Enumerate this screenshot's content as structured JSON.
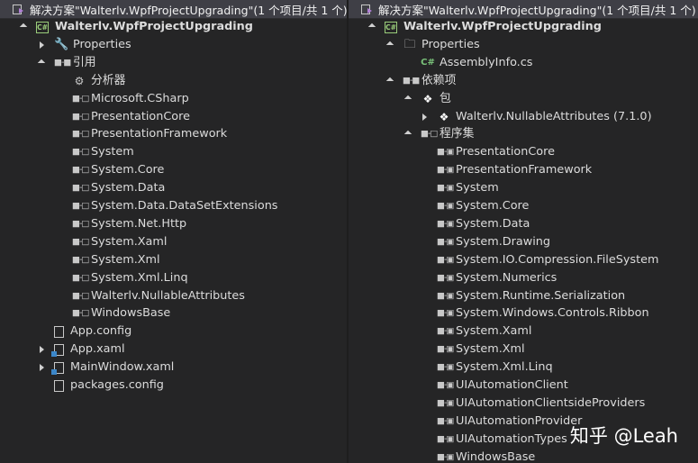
{
  "left": {
    "header": "解决方案\"Walterlv.WpfProjectUpgrading\"(1 个项目/共 1 个)",
    "rows": [
      {
        "depth": 1,
        "toggle": "expanded",
        "icon": "csharp-project-icon",
        "glyph": "C#",
        "label": "Walterlv.WpfProjectUpgrading",
        "bold": true
      },
      {
        "depth": 2,
        "toggle": "collapsed",
        "icon": "wrench-icon",
        "glyph": "🔧",
        "label": "Properties"
      },
      {
        "depth": 2,
        "toggle": "expanded",
        "icon": "references-icon",
        "glyph": "■-■",
        "label": "引用"
      },
      {
        "depth": 3,
        "toggle": "none",
        "icon": "analyzer-icon",
        "glyph": "⚙",
        "label": "分析器"
      },
      {
        "depth": 3,
        "toggle": "none",
        "icon": "reference-icon",
        "glyph": "■-□",
        "label": "Microsoft.CSharp"
      },
      {
        "depth": 3,
        "toggle": "none",
        "icon": "reference-icon",
        "glyph": "■-□",
        "label": "PresentationCore"
      },
      {
        "depth": 3,
        "toggle": "none",
        "icon": "reference-icon",
        "glyph": "■-□",
        "label": "PresentationFramework"
      },
      {
        "depth": 3,
        "toggle": "none",
        "icon": "reference-icon",
        "glyph": "■-□",
        "label": "System"
      },
      {
        "depth": 3,
        "toggle": "none",
        "icon": "reference-icon",
        "glyph": "■-□",
        "label": "System.Core"
      },
      {
        "depth": 3,
        "toggle": "none",
        "icon": "reference-icon",
        "glyph": "■-□",
        "label": "System.Data"
      },
      {
        "depth": 3,
        "toggle": "none",
        "icon": "reference-icon",
        "glyph": "■-□",
        "label": "System.Data.DataSetExtensions"
      },
      {
        "depth": 3,
        "toggle": "none",
        "icon": "reference-icon",
        "glyph": "■-□",
        "label": "System.Net.Http"
      },
      {
        "depth": 3,
        "toggle": "none",
        "icon": "reference-icon",
        "glyph": "■-□",
        "label": "System.Xaml"
      },
      {
        "depth": 3,
        "toggle": "none",
        "icon": "reference-icon",
        "glyph": "■-□",
        "label": "System.Xml"
      },
      {
        "depth": 3,
        "toggle": "none",
        "icon": "reference-icon",
        "glyph": "■-□",
        "label": "System.Xml.Linq"
      },
      {
        "depth": 3,
        "toggle": "none",
        "icon": "reference-icon",
        "glyph": "■-□",
        "label": "Walterlv.NullableAttributes"
      },
      {
        "depth": 3,
        "toggle": "none",
        "icon": "reference-icon",
        "glyph": "■-□",
        "label": "WindowsBase"
      },
      {
        "depth": 2,
        "toggle": "none",
        "icon": "config-file-icon",
        "glyph": "",
        "label": "App.config"
      },
      {
        "depth": 2,
        "toggle": "collapsed",
        "icon": "xaml-file-icon",
        "glyph": "",
        "label": "App.xaml"
      },
      {
        "depth": 2,
        "toggle": "collapsed",
        "icon": "xaml-file-icon",
        "glyph": "",
        "label": "MainWindow.xaml"
      },
      {
        "depth": 2,
        "toggle": "none",
        "icon": "config-file-icon",
        "glyph": "",
        "label": "packages.config"
      }
    ]
  },
  "right": {
    "header": "解决方案\"Walterlv.WpfProjectUpgrading\"(1 个项目/共 1 个)",
    "rows": [
      {
        "depth": 1,
        "toggle": "expanded",
        "icon": "csharp-project-icon",
        "glyph": "C#",
        "label": "Walterlv.WpfProjectUpgrading",
        "bold": true
      },
      {
        "depth": 2,
        "toggle": "expanded",
        "icon": "properties-icon",
        "glyph": "🗀",
        "label": "Properties"
      },
      {
        "depth": 3,
        "toggle": "none",
        "icon": "csharp-file-icon",
        "glyph": "C#",
        "label": "AssemblyInfo.cs"
      },
      {
        "depth": 2,
        "toggle": "expanded",
        "icon": "dependencies-icon",
        "glyph": "■-■",
        "label": "依赖项"
      },
      {
        "depth": 3,
        "toggle": "expanded",
        "icon": "package-icon",
        "glyph": "❖",
        "label": "包"
      },
      {
        "depth": 4,
        "toggle": "collapsed",
        "icon": "package-icon",
        "glyph": "❖",
        "label": "Walterlv.NullableAttributes (7.1.0)"
      },
      {
        "depth": 3,
        "toggle": "expanded",
        "icon": "assemblies-icon",
        "glyph": "■-□",
        "label": "程序集"
      },
      {
        "depth": 4,
        "toggle": "none",
        "icon": "assembly-icon",
        "glyph": "■-▣",
        "label": "PresentationCore"
      },
      {
        "depth": 4,
        "toggle": "none",
        "icon": "assembly-icon",
        "glyph": "■-▣",
        "label": "PresentationFramework"
      },
      {
        "depth": 4,
        "toggle": "none",
        "icon": "assembly-icon",
        "glyph": "■-▣",
        "label": "System"
      },
      {
        "depth": 4,
        "toggle": "none",
        "icon": "assembly-icon",
        "glyph": "■-▣",
        "label": "System.Core"
      },
      {
        "depth": 4,
        "toggle": "none",
        "icon": "assembly-icon",
        "glyph": "■-▣",
        "label": "System.Data"
      },
      {
        "depth": 4,
        "toggle": "none",
        "icon": "assembly-icon",
        "glyph": "■-▣",
        "label": "System.Drawing"
      },
      {
        "depth": 4,
        "toggle": "none",
        "icon": "assembly-icon",
        "glyph": "■-▣",
        "label": "System.IO.Compression.FileSystem"
      },
      {
        "depth": 4,
        "toggle": "none",
        "icon": "assembly-icon",
        "glyph": "■-▣",
        "label": "System.Numerics"
      },
      {
        "depth": 4,
        "toggle": "none",
        "icon": "assembly-icon",
        "glyph": "■-▣",
        "label": "System.Runtime.Serialization"
      },
      {
        "depth": 4,
        "toggle": "none",
        "icon": "assembly-icon",
        "glyph": "■-▣",
        "label": "System.Windows.Controls.Ribbon"
      },
      {
        "depth": 4,
        "toggle": "none",
        "icon": "assembly-icon",
        "glyph": "■-▣",
        "label": "System.Xaml"
      },
      {
        "depth": 4,
        "toggle": "none",
        "icon": "assembly-icon",
        "glyph": "■-▣",
        "label": "System.Xml"
      },
      {
        "depth": 4,
        "toggle": "none",
        "icon": "assembly-icon",
        "glyph": "■-▣",
        "label": "System.Xml.Linq"
      },
      {
        "depth": 4,
        "toggle": "none",
        "icon": "assembly-icon",
        "glyph": "■-▣",
        "label": "UIAutomationClient"
      },
      {
        "depth": 4,
        "toggle": "none",
        "icon": "assembly-icon",
        "glyph": "■-▣",
        "label": "UIAutomationClientsideProviders"
      },
      {
        "depth": 4,
        "toggle": "none",
        "icon": "assembly-icon",
        "glyph": "■-▣",
        "label": "UIAutomationProvider"
      },
      {
        "depth": 4,
        "toggle": "none",
        "icon": "assembly-icon",
        "glyph": "■-▣",
        "label": "UIAutomationTypes"
      },
      {
        "depth": 4,
        "toggle": "none",
        "icon": "assembly-icon",
        "glyph": "■-▣",
        "label": "WindowsBase"
      }
    ]
  },
  "watermark": "知乎 @Leah",
  "colors": {
    "background": "#252526",
    "header": "#3f3f46",
    "text": "#dcdcdc",
    "project_icon": "#9acd7a",
    "xaml_accent": "#3c87c9"
  }
}
